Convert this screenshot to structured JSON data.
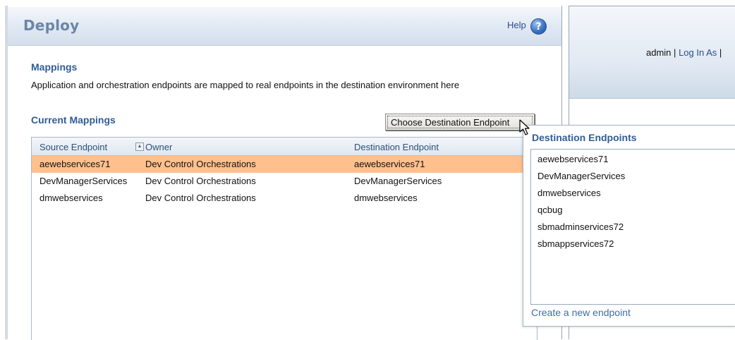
{
  "deploy_panel": {
    "title": "Deploy",
    "help_label": "Help",
    "help_icon": "help-question-icon"
  },
  "mappings": {
    "heading": "Mappings",
    "description": "Application and orchestration endpoints are mapped to real endpoints in the destination environment here"
  },
  "current_mappings": {
    "heading": "Current Mappings",
    "columns": [
      "Source Endpoint",
      "Owner",
      "Destination Endpoint"
    ],
    "rows": [
      {
        "source": "aewebservices71",
        "owner": "Dev Control Orchestrations",
        "destination": "aewebservices71",
        "selected": true
      },
      {
        "source": "DevManagerServices",
        "owner": "Dev Control Orchestrations",
        "destination": "DevManagerServices",
        "selected": false
      },
      {
        "source": "dmwebservices",
        "owner": "Dev Control Orchestrations",
        "destination": "dmwebservices",
        "selected": false
      }
    ],
    "selected_row_color": "#ffc08e"
  },
  "choose_button_label": "Choose Destination Endpoint",
  "user_bar": {
    "user": "admin",
    "separator": "|",
    "login_as": "Log In As",
    "trailing_separator": "|"
  },
  "destination_popup": {
    "title": "Destination Endpoints",
    "items": [
      "aewebservices71",
      "DevManagerServices",
      "dmwebservices",
      "qcbug",
      "sbmadminservices72",
      "sbmappservices72"
    ],
    "create_link": "Create a new endpoint"
  },
  "colors": {
    "heading_blue": "#2f5d96",
    "title_blue": "#6b86a6",
    "link_blue": "#2a4d8a"
  }
}
